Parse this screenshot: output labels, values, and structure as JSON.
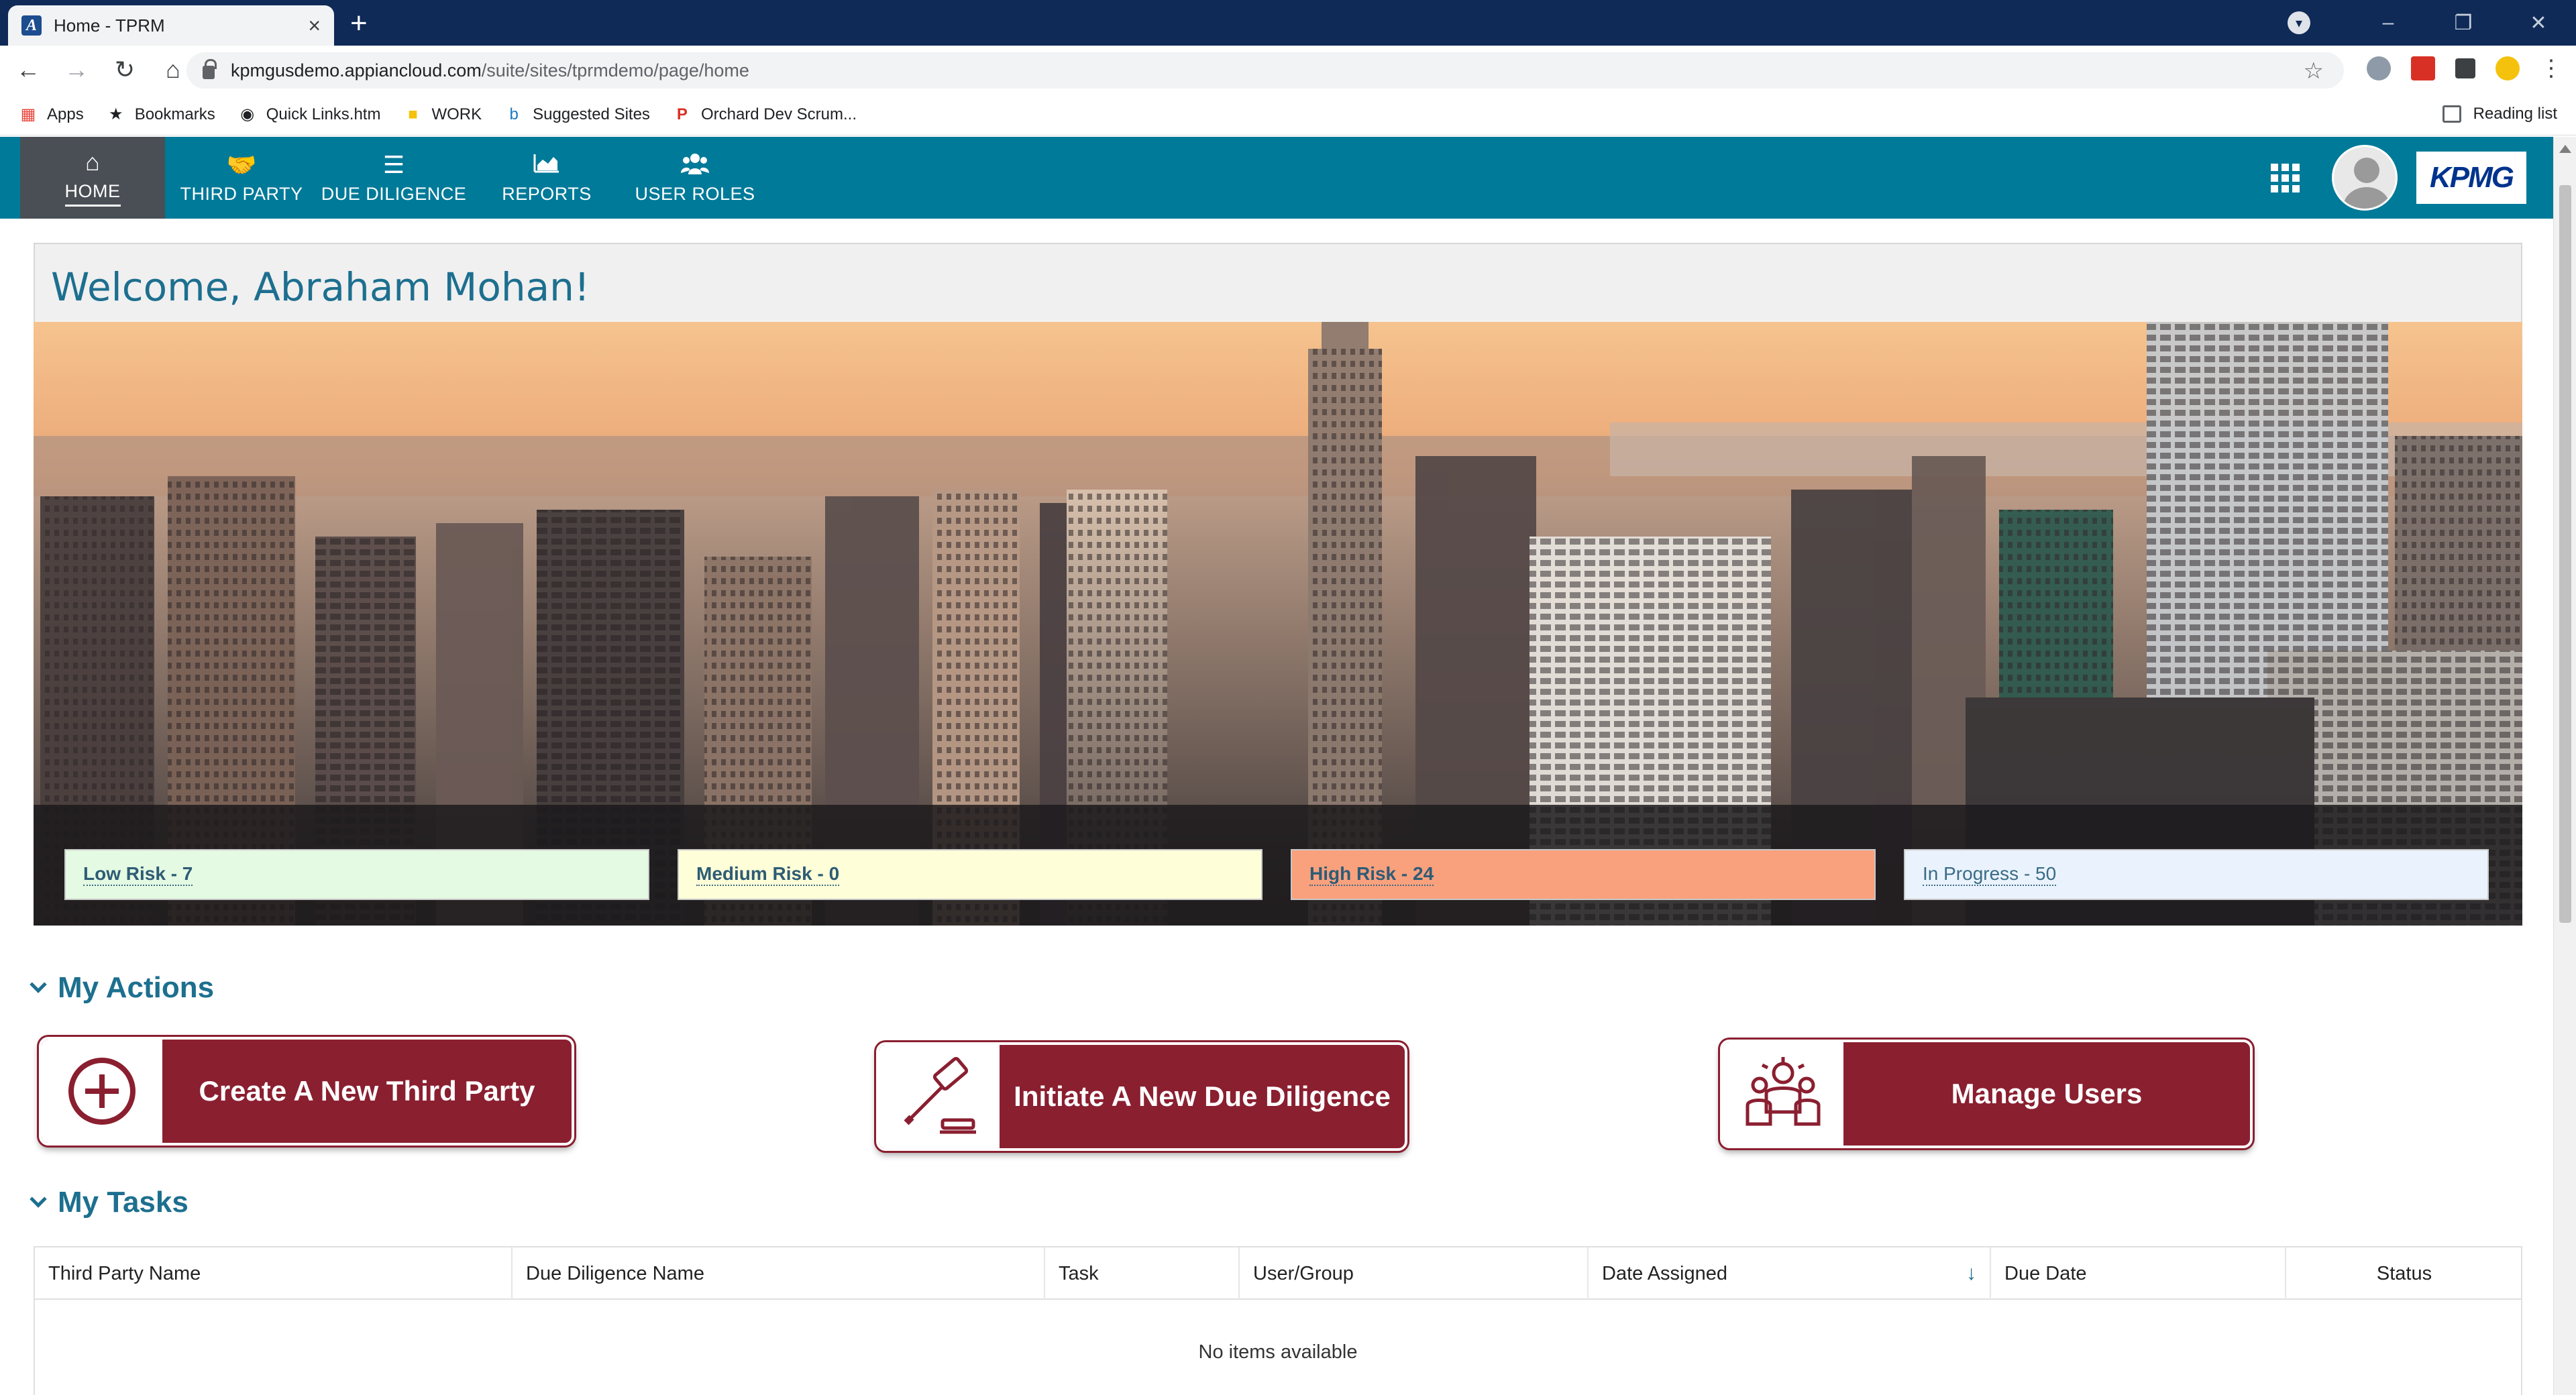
{
  "browser": {
    "tab_title": "Home - TPRM",
    "url_host": "kpmgusdemo.appiancloud.com",
    "url_path": "/suite/sites/tprmdemo/page/home",
    "bookmarks": [
      "Apps",
      "Bookmarks",
      "Quick Links.htm",
      "WORK",
      "Suggested Sites",
      "Orchard Dev Scrum..."
    ],
    "reading_list": "Reading list"
  },
  "nav": {
    "items": [
      {
        "label": "HOME",
        "icon": "home-icon"
      },
      {
        "label": "THIRD PARTY",
        "icon": "handshake-icon"
      },
      {
        "label": "DUE DILIGENCE",
        "icon": "list-icon"
      },
      {
        "label": "REPORTS",
        "icon": "area-chart-icon"
      },
      {
        "label": "USER ROLES",
        "icon": "users-icon"
      }
    ],
    "logo": "KPMG"
  },
  "welcome": "Welcome, Abraham Mohan!",
  "risk": {
    "low": "Low Risk - 7",
    "medium": "Medium Risk - 0",
    "high": "High Risk - 24",
    "in_progress": "In Progress - 50"
  },
  "actions": {
    "heading": "My Actions",
    "create": "Create A New Third Party",
    "initiate": "Initiate A New Due Diligence",
    "manage": "Manage Users"
  },
  "tasks": {
    "heading": "My Tasks",
    "columns": [
      "Third Party Name",
      "Due Diligence Name",
      "Task",
      "User/Group",
      "Date Assigned",
      "Due Date",
      "Status"
    ],
    "empty": "No items available"
  },
  "colors": {
    "brand": "#007a99",
    "action": "#8a1f30",
    "heading": "#1d6f8f"
  }
}
